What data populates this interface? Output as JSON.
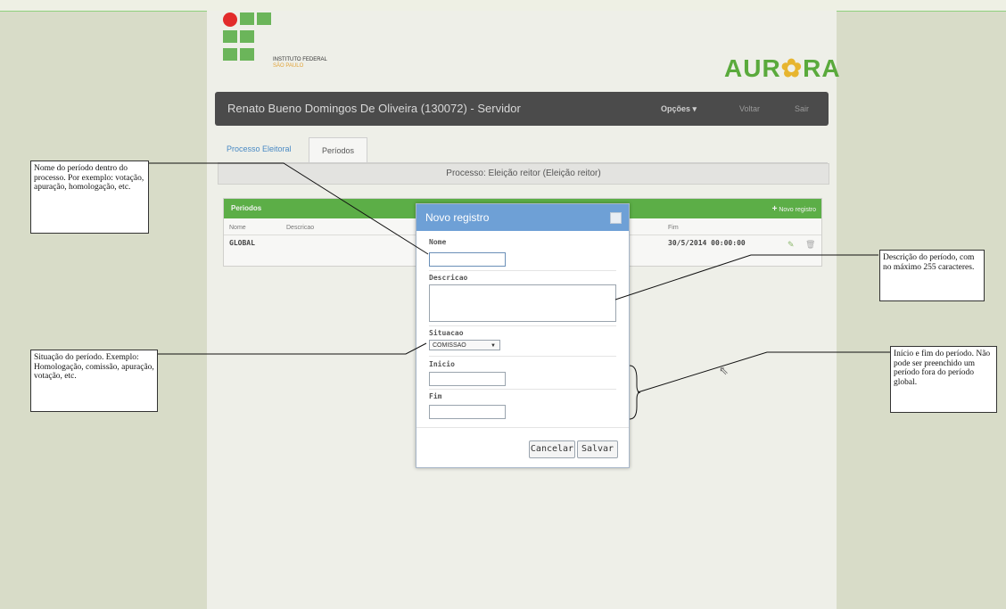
{
  "header": {
    "institution": "INSTITUTO FEDERAL",
    "campus": "SÃO PAULO",
    "app_name_left": "AUR",
    "app_name_mid": "✿",
    "app_name_right": "RA"
  },
  "navbar": {
    "user": "Renato Bueno Domingos De Oliveira (130072) - Servidor",
    "opcoes": "Opções ▾",
    "voltar": "Voltar",
    "sair": "Sair"
  },
  "tabs": [
    {
      "label": "Processo Eleitoral"
    },
    {
      "label": "Períodos"
    }
  ],
  "process_title": "Processo: Eleição reitor (Eleição reitor)",
  "periods_panel": {
    "title": "Periodos",
    "new_record_icon": "+",
    "new_record": "Novo registro",
    "columns": [
      "Nome",
      "Descricao",
      "Fim"
    ],
    "rows": [
      {
        "nome": "GLOBAL",
        "fim": "30/5/2014 00:00:00"
      }
    ]
  },
  "modal": {
    "title": "Novo registro",
    "nome_label": "Nome",
    "descricao_label": "Descricao",
    "situacao_label": "Situacao",
    "situacao_value": "COMISSAO",
    "inicio_label": "Inicio",
    "fim_label": "Fim",
    "cancel_label": "Cancelar",
    "save_label": "Salvar"
  },
  "annotations": {
    "nome": "Nome do período dentro do processo. Por exemplo: votação, apuração, homologação, etc.",
    "descricao": "Descrição do período, com no máximo 255 caracteres.",
    "situacao": "Situação do período. Exemplo: Homologação, comissão, apuração, votação, etc.",
    "inicio_fim": "Início e fim do período. Não pode ser preenchido um período fora do período global."
  },
  "colors": {
    "navbar": "#4b4b4b",
    "panel_header": "#5cae47",
    "modal_header": "#6ea0d6",
    "link": "#4a8ac4"
  }
}
